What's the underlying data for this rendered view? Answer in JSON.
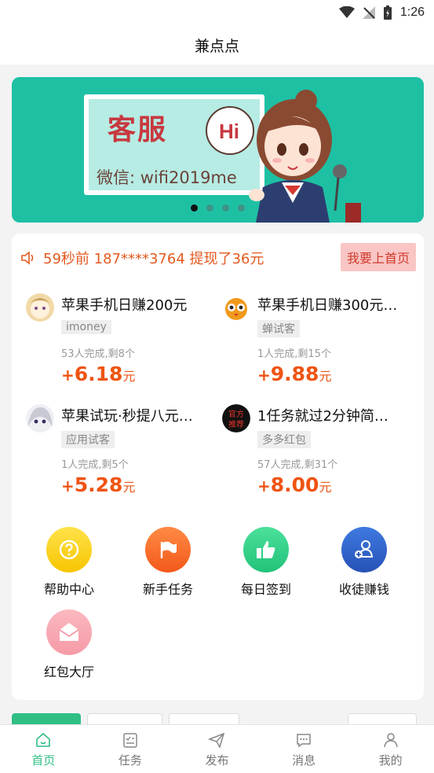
{
  "status": {
    "time": "1:26"
  },
  "header": {
    "title": "兼点点"
  },
  "banner": {
    "board_title": "客服",
    "board_wechat": "微信: wifi2019me",
    "bubble": "Hi",
    "dots": 4,
    "active_dot": 0
  },
  "notice": {
    "text": "59秒前 187****3764 提现了36元",
    "button": "我要上首页"
  },
  "tasks": [
    {
      "title": "苹果手机日赚200元",
      "tag": "imoney",
      "meta": "53人完成,剩8个",
      "plus": "+",
      "amount": "6.18",
      "unit": "元"
    },
    {
      "title": "苹果手机日赚300元…",
      "tag": "蝉试客",
      "meta": "1人完成,剩15个",
      "plus": "+",
      "amount": "9.88",
      "unit": "元"
    },
    {
      "title": "苹果试玩·秒提八元…",
      "tag": "应用试客",
      "meta": "1人完成,剩5个",
      "plus": "+",
      "amount": "5.28",
      "unit": "元"
    },
    {
      "title": "1任务就过2分钟简…",
      "tag": "多多红包",
      "meta": "57人完成,剩31个",
      "plus": "+",
      "amount": "8.00",
      "unit": "元",
      "avatar_text_1": "官方",
      "avatar_text_2": "推荐"
    }
  ],
  "shortcuts": [
    {
      "label": "帮助中心",
      "icon": "question-icon",
      "color": "#ffd21f"
    },
    {
      "label": "新手任务",
      "icon": "flag-icon",
      "color": "#f86b2e"
    },
    {
      "label": "每日签到",
      "icon": "thumbs-up-icon",
      "color": "#2fd28a"
    },
    {
      "label": "收徒赚钱",
      "icon": "add-user-icon",
      "color": "#2f62c9"
    },
    {
      "label": "红包大厅",
      "icon": "envelope-icon",
      "color": "#f8aeb6"
    }
  ],
  "tabs": [
    {
      "label": "首页",
      "icon": "home-icon",
      "active": true
    },
    {
      "label": "任务",
      "icon": "task-list-icon",
      "active": false
    },
    {
      "label": "发布",
      "icon": "send-icon",
      "active": false
    },
    {
      "label": "消息",
      "icon": "message-icon",
      "active": false
    },
    {
      "label": "我的",
      "icon": "user-icon",
      "active": false
    }
  ],
  "colors": {
    "accent": "#2fbf85",
    "reward": "#ee5413",
    "notice": "#e35a20",
    "banner_bg": "#1ec0a4"
  }
}
